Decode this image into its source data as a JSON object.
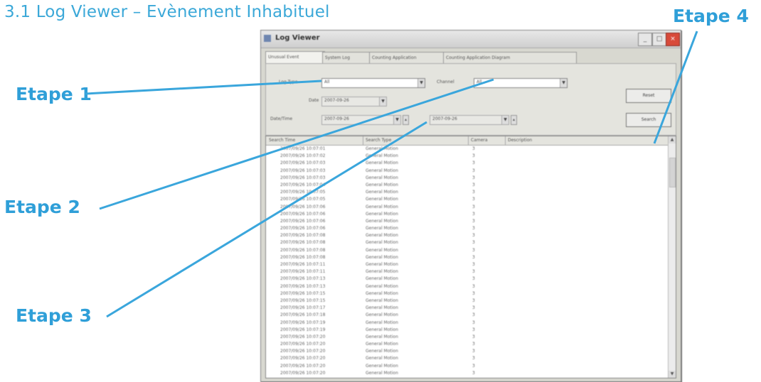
{
  "slide": {
    "title": "3.1 Log Viewer – Evènement Inhabituel",
    "steps": [
      "Etape 1",
      "Etape 2",
      "Etape 3",
      "Etape 4"
    ]
  },
  "window": {
    "title": "Log Viewer",
    "tabs": [
      "Unusual Event",
      "System Log",
      "Counting Application",
      "Counting Application Diagram"
    ],
    "filter": {
      "log_type_label": "Log Type",
      "log_type_value": "All",
      "channel_label": "Channel",
      "channel_value": "All",
      "date_label": "Date",
      "date_value": "2007-09-26",
      "date_time_label": "Date/Time",
      "from_value": "2007-09-26",
      "to_value": "2007-09-26",
      "reset_label": "Reset",
      "search_label": "Search"
    },
    "table": {
      "columns": [
        "Search Time",
        "Search Type",
        "Camera",
        "Description"
      ],
      "rows": [
        [
          "2007/09/26 10:07:01",
          "General Motion",
          "3"
        ],
        [
          "2007/09/26 10:07:02",
          "General Motion",
          "3"
        ],
        [
          "2007/09/26 10:07:03",
          "General Motion",
          "3"
        ],
        [
          "2007/09/26 10:07:03",
          "General Motion",
          "3"
        ],
        [
          "2007/09/26 10:07:03",
          "General Motion",
          "3"
        ],
        [
          "2007/09/26 10:07:04",
          "General Motion",
          "3"
        ],
        [
          "2007/09/26 10:07:05",
          "General Motion",
          "3"
        ],
        [
          "2007/09/26 10:07:05",
          "General Motion",
          "3"
        ],
        [
          "2007/09/26 10:07:06",
          "General Motion",
          "3"
        ],
        [
          "2007/09/26 10:07:06",
          "General Motion",
          "3"
        ],
        [
          "2007/09/26 10:07:06",
          "General Motion",
          "3"
        ],
        [
          "2007/09/26 10:07:06",
          "General Motion",
          "3"
        ],
        [
          "2007/09/26 10:07:08",
          "General Motion",
          "3"
        ],
        [
          "2007/09/26 10:07:08",
          "General Motion",
          "3"
        ],
        [
          "2007/09/26 10:07:08",
          "General Motion",
          "3"
        ],
        [
          "2007/09/26 10:07:08",
          "General Motion",
          "3"
        ],
        [
          "2007/09/26 10:07:11",
          "General Motion",
          "3"
        ],
        [
          "2007/09/26 10:07:11",
          "General Motion",
          "3"
        ],
        [
          "2007/09/26 10:07:13",
          "General Motion",
          "3"
        ],
        [
          "2007/09/26 10:07:13",
          "General Motion",
          "3"
        ],
        [
          "2007/09/26 10:07:15",
          "General Motion",
          "3"
        ],
        [
          "2007/09/26 10:07:15",
          "General Motion",
          "3"
        ],
        [
          "2007/09/26 10:07:17",
          "General Motion",
          "3"
        ],
        [
          "2007/09/26 10:07:18",
          "General Motion",
          "3"
        ],
        [
          "2007/09/26 10:07:19",
          "General Motion",
          "3"
        ],
        [
          "2007/09/26 10:07:19",
          "General Motion",
          "3"
        ],
        [
          "2007/09/26 10:07:20",
          "General Motion",
          "3"
        ],
        [
          "2007/09/26 10:07:20",
          "General Motion",
          "3"
        ],
        [
          "2007/09/26 10:07:20",
          "General Motion",
          "3"
        ],
        [
          "2007/09/26 10:07:20",
          "General Motion",
          "3"
        ],
        [
          "2007/09/26 10:07:20",
          "General Motion",
          "3"
        ],
        [
          "2007/09/26 10:07:20",
          "General Motion",
          "3"
        ]
      ]
    }
  },
  "colors": {
    "title": "#3ba8d8",
    "step_label": "#2f9fd8",
    "callout_line": "#3aa6dc",
    "close_button": "#d84a3a"
  },
  "icons": [
    "window-icon",
    "minimize-icon",
    "maximize-icon",
    "close-icon",
    "chevron-down-icon",
    "spin-icon"
  ]
}
